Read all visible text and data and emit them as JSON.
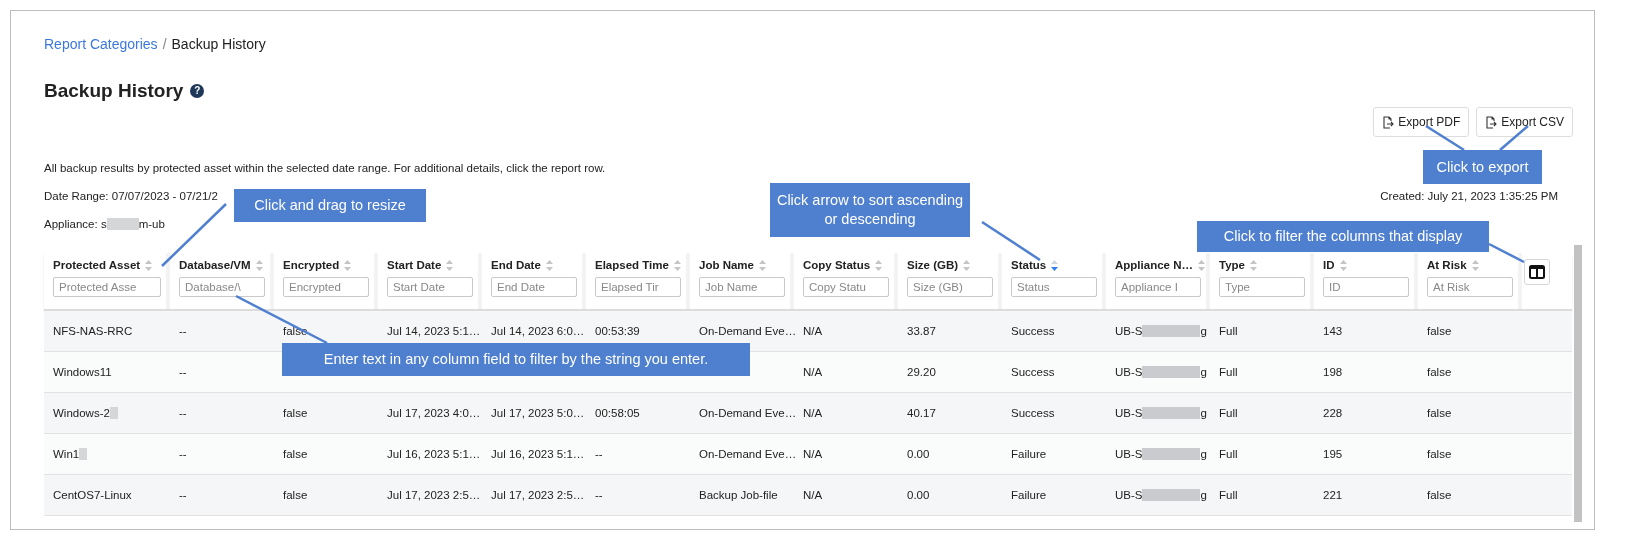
{
  "breadcrumb": {
    "link": "Report Categories",
    "separator": "/",
    "current": "Backup History"
  },
  "title": "Backup History",
  "help_glyph": "?",
  "export_buttons": [
    "Export PDF",
    "Export CSV"
  ],
  "description": "All backup results by protected asset within the selected date range. For additional details, click the report row.",
  "date_range": "Date Range: 07/07/2023 - 07/21/2",
  "created": "Created: July 21, 2023 1:35:25 PM",
  "appliance": {
    "kind": "redacted",
    "parts": [
      "Appliance: s",
      "m-ub"
    ]
  },
  "table": {
    "columns": [
      {
        "label": "Protected Asset",
        "placeholder": "Protected Asse",
        "sort_active": false
      },
      {
        "label": "Database/VM",
        "placeholder": "Database/\\",
        "sort_active": false
      },
      {
        "label": "Encrypted",
        "placeholder": "Encrypted",
        "sort_active": false
      },
      {
        "label": "Start Date",
        "placeholder": "Start Date",
        "sort_active": false
      },
      {
        "label": "End Date",
        "placeholder": "End Date",
        "sort_active": false
      },
      {
        "label": "Elapsed Time",
        "placeholder": "Elapsed Tir",
        "sort_active": false
      },
      {
        "label": "Job Name",
        "placeholder": "Job Name",
        "sort_active": false
      },
      {
        "label": "Copy Status",
        "placeholder": "Copy Statu",
        "sort_active": false
      },
      {
        "label": "Size (GB)",
        "placeholder": "Size (GB)",
        "sort_active": false
      },
      {
        "label": "Status",
        "placeholder": "Status",
        "sort_active": true
      },
      {
        "label": "Appliance N…",
        "placeholder": "Appliance I",
        "sort_active": false
      },
      {
        "label": "Type",
        "placeholder": "Type",
        "sort_active": false
      },
      {
        "label": "ID",
        "placeholder": "ID",
        "sort_active": false
      },
      {
        "label": "At Risk",
        "placeholder": "At Risk",
        "sort_active": false
      }
    ],
    "rows": [
      [
        "NFS-NAS-RRC",
        "--",
        "false",
        "Jul 14, 2023 5:1…",
        "Jul 14, 2023 6:0…",
        "00:53:39",
        "On-Demand Eve…",
        "N/A",
        "33.87",
        "Success",
        {
          "kind": "redacted",
          "parts": [
            "UB-S",
            "g"
          ]
        },
        "Full",
        "143",
        "false"
      ],
      [
        "Windows11",
        "--",
        null,
        null,
        null,
        null,
        null,
        "N/A",
        "29.20",
        "Success",
        {
          "kind": "redacted",
          "parts": [
            "UB-S",
            "g"
          ]
        },
        "Full",
        "198",
        "false"
      ],
      [
        "Windows-2",
        "--",
        "false",
        "Jul 17, 2023 4:0…",
        "Jul 17, 2023 5:0…",
        "00:58:05",
        "On-Demand Eve…",
        "N/A",
        "40.17",
        "Success",
        {
          "kind": "redacted",
          "parts": [
            "UB-S",
            "g"
          ]
        },
        "Full",
        "228",
        "false"
      ],
      [
        "Win1",
        "--",
        "false",
        "Jul 16, 2023 5:1…",
        "Jul 16, 2023 5:1…",
        "--",
        "On-Demand Eve…",
        "N/A",
        "0.00",
        "Failure",
        {
          "kind": "redacted",
          "parts": [
            "UB-S",
            "g"
          ]
        },
        "Full",
        "195",
        "false"
      ],
      [
        "CentOS7-Linux",
        "--",
        "false",
        "Jul 17, 2023 2:5…",
        "Jul 17, 2023 2:5…",
        "--",
        "Backup Job-file",
        "N/A",
        "0.00",
        "Failure",
        {
          "kind": "redacted",
          "parts": [
            "UB-S",
            "g"
          ]
        },
        "Full",
        "221",
        "false"
      ]
    ]
  },
  "annotations": [
    {
      "text": "Click and drag to resize"
    },
    {
      "text": "Click to export"
    },
    {
      "text": "Click arrow to sort ascending or descending"
    },
    {
      "text": "Click to filter the columns that display"
    },
    {
      "text": "Enter text in any column field to filter by the string you enter."
    }
  ]
}
